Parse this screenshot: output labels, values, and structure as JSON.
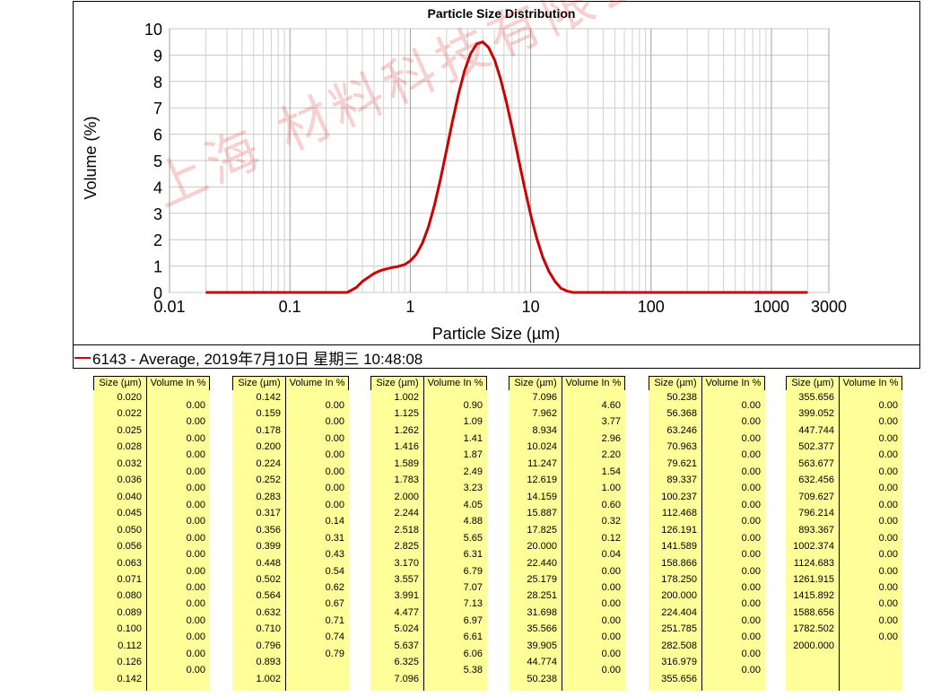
{
  "chart_data": {
    "type": "line",
    "title": "Particle Size Distribution",
    "xlabel": "Particle Size (µm)",
    "ylabel": "Volume (%)",
    "xscale": "log",
    "xlim": [
      0.01,
      3000
    ],
    "ylim": [
      0,
      10
    ],
    "xticks": [
      "0.01",
      "0.1",
      "1",
      "10",
      "100",
      "1000",
      "3000"
    ],
    "yticks": [
      "0",
      "1",
      "2",
      "3",
      "4",
      "5",
      "6",
      "7",
      "8",
      "9",
      "10"
    ],
    "grid": true,
    "legend": "bottom-left",
    "series": [
      {
        "name": "6143 - Average, 2019年7月10日 星期三 10:48:08",
        "color": "#cc0000",
        "x": [
          0.02,
          0.3,
          0.356,
          0.399,
          0.448,
          0.502,
          0.564,
          0.632,
          0.71,
          0.796,
          0.893,
          1.002,
          1.125,
          1.262,
          1.416,
          1.589,
          1.783,
          2.0,
          2.244,
          2.518,
          2.825,
          3.17,
          3.557,
          3.991,
          4.477,
          5.024,
          5.637,
          6.325,
          7.096,
          7.962,
          8.934,
          10.024,
          11.247,
          12.619,
          14.159,
          15.887,
          17.825,
          20.0,
          22.44,
          2000.0
        ],
        "y": [
          0,
          0,
          0.14,
          0.31,
          0.43,
          0.54,
          0.62,
          0.67,
          0.71,
          0.74,
          0.79,
          0.9,
          1.09,
          1.41,
          1.87,
          2.49,
          3.23,
          4.05,
          4.88,
          5.65,
          6.31,
          6.79,
          7.07,
          7.13,
          6.97,
          6.61,
          6.06,
          5.38,
          4.6,
          3.77,
          2.96,
          2.2,
          1.54,
          1.0,
          0.6,
          0.32,
          0.12,
          0.04,
          0.0,
          0.0
        ]
      }
    ]
  },
  "legend_text": "6143 - Average, 2019年7月10日 星期三 10:48:08",
  "watermark": "上海 材料科技有限公司",
  "tables": {
    "header_size": "Size (µm)",
    "header_vol": "Volume In %",
    "columns": [
      {
        "sizes": [
          "0.020",
          "0.022",
          "0.025",
          "0.028",
          "0.032",
          "0.036",
          "0.040",
          "0.045",
          "0.050",
          "0.056",
          "0.063",
          "0.071",
          "0.080",
          "0.089",
          "0.100",
          "0.112",
          "0.126",
          "0.142"
        ],
        "vols": [
          "0.00",
          "0.00",
          "0.00",
          "0.00",
          "0.00",
          "0.00",
          "0.00",
          "0.00",
          "0.00",
          "0.00",
          "0.00",
          "0.00",
          "0.00",
          "0.00",
          "0.00",
          "0.00",
          "0.00"
        ]
      },
      {
        "sizes": [
          "0.142",
          "0.159",
          "0.178",
          "0.200",
          "0.224",
          "0.252",
          "0.283",
          "0.317",
          "0.356",
          "0.399",
          "0.448",
          "0.502",
          "0.564",
          "0.632",
          "0.710",
          "0.796",
          "0.893",
          "1.002"
        ],
        "vols": [
          "0.00",
          "0.00",
          "0.00",
          "0.00",
          "0.00",
          "0.00",
          "0.00",
          "0.14",
          "0.31",
          "0.43",
          "0.54",
          "0.62",
          "0.67",
          "0.71",
          "0.74",
          "0.79"
        ]
      },
      {
        "sizes": [
          "1.002",
          "1.125",
          "1.262",
          "1.416",
          "1.589",
          "1.783",
          "2.000",
          "2.244",
          "2.518",
          "2.825",
          "3.170",
          "3.557",
          "3.991",
          "4.477",
          "5.024",
          "5.637",
          "6.325",
          "7.096"
        ],
        "vols": [
          "0.90",
          "1.09",
          "1.41",
          "1.87",
          "2.49",
          "3.23",
          "4.05",
          "4.88",
          "5.65",
          "6.31",
          "6.79",
          "7.07",
          "7.13",
          "6.97",
          "6.61",
          "6.06",
          "5.38"
        ]
      },
      {
        "sizes": [
          "7.096",
          "7.962",
          "8.934",
          "10.024",
          "11.247",
          "12.619",
          "14.159",
          "15.887",
          "17.825",
          "20.000",
          "22.440",
          "25.179",
          "28.251",
          "31.698",
          "35.566",
          "39.905",
          "44.774",
          "50.238"
        ],
        "vols": [
          "4.60",
          "3.77",
          "2.96",
          "2.20",
          "1.54",
          "1.00",
          "0.60",
          "0.32",
          "0.12",
          "0.04",
          "0.00",
          "0.00",
          "0.00",
          "0.00",
          "0.00",
          "0.00",
          "0.00"
        ]
      },
      {
        "sizes": [
          "50.238",
          "56.368",
          "63.246",
          "70.963",
          "79.621",
          "89.337",
          "100.237",
          "112.468",
          "126.191",
          "141.589",
          "158.866",
          "178.250",
          "200.000",
          "224.404",
          "251.785",
          "282.508",
          "316.979",
          "355.656"
        ],
        "vols": [
          "0.00",
          "0.00",
          "0.00",
          "0.00",
          "0.00",
          "0.00",
          "0.00",
          "0.00",
          "0.00",
          "0.00",
          "0.00",
          "0.00",
          "0.00",
          "0.00",
          "0.00",
          "0.00",
          "0.00"
        ]
      },
      {
        "sizes": [
          "355.656",
          "399.052",
          "447.744",
          "502.377",
          "563.677",
          "632.456",
          "709.627",
          "796.214",
          "893.367",
          "1002.374",
          "1124.683",
          "1261.915",
          "1415.892",
          "1588.656",
          "1782.502",
          "2000.000"
        ],
        "vols": [
          "0.00",
          "0.00",
          "0.00",
          "0.00",
          "0.00",
          "0.00",
          "0.00",
          "0.00",
          "0.00",
          "0.00",
          "0.00",
          "0.00",
          "0.00",
          "0.00",
          "0.00"
        ]
      }
    ]
  }
}
